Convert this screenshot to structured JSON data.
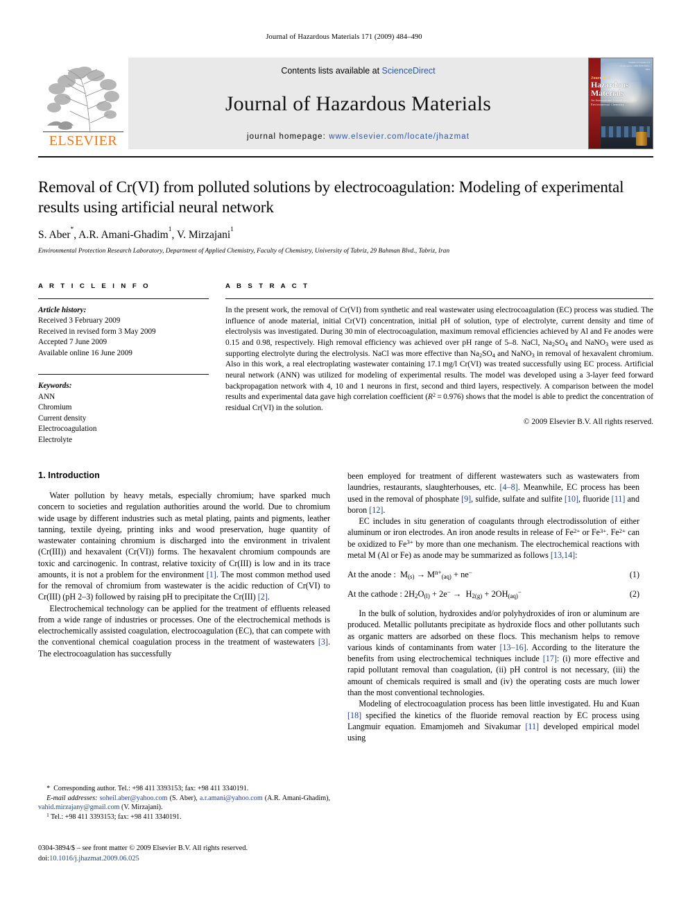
{
  "running_head": "Journal of Hazardous Materials 171 (2009) 484–490",
  "masthead": {
    "publisher_name": "ELSEVIER",
    "contents_prefix": "Contents lists available at ",
    "contents_link": "ScienceDirect",
    "journal_title": "Journal of Hazardous Materials",
    "homepage_prefix": "journal homepage:",
    "homepage_url": "www.elsevier.com/locate/jhazmat",
    "cover": {
      "line_small": "Journal of",
      "line_big_1": "Hazardous",
      "line_big_2": "Materials",
      "line_sub_1": "An International Journal devoted to",
      "line_sub_2": "Environmental Chemistry",
      "top_text_1": "Volume 171 Issues 1-3",
      "top_text_2": "15 November 2009 ISSN 0304-3894"
    }
  },
  "title": "Removal of Cr(VI) from polluted solutions by electrocoagulation: Modeling of experimental results using artificial neural network",
  "authors_html": "S. Aber<sup>*</sup>, A.R. Amani-Ghadim<sup>1</sup>, V. Mirzajani<sup>1</sup>",
  "affiliation": "Environmental Protection Research Laboratory, Department of Applied Chemistry, Faculty of Chemistry, University of Tabriz, 29 Bahman Blvd., Tabriz, Iran",
  "article_info": {
    "heading": "A R T I C L E   I N F O",
    "history_label": "Article history:",
    "history": [
      "Received 3 February 2009",
      "Received in revised form 3 May 2009",
      "Accepted 7 June 2009",
      "Available online 16 June 2009"
    ],
    "keywords_label": "Keywords:",
    "keywords": [
      "ANN",
      "Chromium",
      "Current density",
      "Electrocoagulation",
      "Electrolyte"
    ]
  },
  "abstract": {
    "heading": "A B S T R A C T",
    "body_html": "In the present work, the removal of Cr(VI) from synthetic and real wastewater using electrocoagulation (EC) process was studied. The influence of anode material, initial Cr(VI) concentration, initial pH of solution, type of electrolyte, current density and time of electrolysis was investigated. During 30&thinsp;min of electrocoagulation, maximum removal efficiencies achieved by Al and Fe anodes were 0.15 and 0.98, respectively. High removal efficiency was achieved over pH range of 5–8. NaCl, Na<sub>2</sub>SO<sub>4</sub> and NaNO<sub>3</sub> were used as supporting electrolyte during the electrolysis. NaCl was more effective than Na<sub>2</sub>SO<sub>4</sub> and NaNO<sub>3</sub> in removal of hexavalent chromium. Also in this work, a real electroplating wastewater containing 17.1&thinsp;mg/l Cr(VI) was treated successfully using EC process. Artificial neural network (ANN) was utilized for modeling of experimental results. The model was developed using a 3-layer feed forward backpropagation network with 4, 10 and 1 neurons in first, second and third layers, respectively. A comparison between the model results and experimental data gave high correlation coefficient (<i>R</i><sup>2</sup>&thinsp;=&thinsp;0.976) shows that the model is able to predict the concentration of residual Cr(VI) in the solution.",
    "copyright": "© 2009 Elsevier B.V. All rights reserved."
  },
  "section1": {
    "title": "1.  Introduction",
    "left_paragraphs_html": [
      "Water pollution by heavy metals, especially chromium; have sparked much concern to societies and regulation authorities around the world. Due to chromium wide usage by different industries such as metal plating, paints and pigments, leather tanning, textile dyeing, printing inks and wood preservation, huge quantity of wastewater containing chromium is discharged into the environment in trivalent (Cr(III)) and hexavalent (Cr(VI)) forms. The hexavalent chromium compounds are toxic and carcinogenic. In contrast, relative toxicity of Cr(III) is low and in its trace amounts, it is not a problem for the environment <span class=\"ref\">[1]</span>. The most common method used for the removal of chromium from wastewater is the acidic reduction of Cr(VI) to Cr(III) (pH 2–3) followed by raising pH to precipitate the Cr(III) <span class=\"ref\">[2]</span>.",
      "Electrochemical technology can be applied for the treatment of effluents released from a wide range of industries or processes. One of the electrochemical methods is electrochemically assisted coagulation, electrocoagulation (EC), that can compete with the conventional chemical coagulation process in the treatment of wastewaters <span class=\"ref\">[3]</span>. The electrocoagulation has successfully"
    ],
    "right_paragraphs_html": [
      "been employed for treatment of different wastewaters such as wastewaters from laundries, restaurants, slaughterhouses, etc. <span class=\"ref\">[4–8]</span>. Meanwhile, EC process has been used in the removal of phosphate <span class=\"ref\">[9]</span>, sulfide, sulfate and sulfite <span class=\"ref\">[10]</span>, fluoride <span class=\"ref\">[11]</span> and boron <span class=\"ref\">[12]</span>.",
      "EC includes in situ generation of coagulants through electrodissolution of either aluminum or iron electrodes. An iron anode results in release of Fe<sup>2+</sup> or Fe<sup>3+</sup>. Fe<sup>2+</sup> can be oxidized to Fe<sup>3+</sup> by more than one mechanism. The electrochemical reactions with metal M (Al or Fe) as anode may be summarized as follows <span class=\"ref\">[13,14]</span>:"
    ],
    "equations": [
      {
        "body_html": "At the anode :&nbsp; M<sub>(s)</sub> → M<sup>n+</sup><sub>(aq)</sub> + ne<sup>−</sup>",
        "number": "(1)"
      },
      {
        "body_html": "At the cathode : 2H<sub>2</sub>O<sub>(l)</sub> + 2e<sup>−</sup> → &nbsp;H<sub>2(g)</sub> + 2OH<sub>(aq)</sub><sup>−</sup>",
        "number": "(2)"
      }
    ],
    "right_paragraphs_after_eq_html": [
      "In the bulk of solution, hydroxides and/or polyhydroxides of iron or aluminum are produced. Metallic pollutants precipitate as hydroxide flocs and other pollutants such as organic matters are adsorbed on these flocs. This mechanism helps to remove various kinds of contaminants from water <span class=\"ref\">[13–16]</span>. According to the literature the benefits from using electrochemical techniques include <span class=\"ref\">[17]</span>: (i) more effective and rapid pollutant removal than coagulation, (ii) pH control is not necessary, (iii) the amount of chemicals required is small and (iv) the operating costs are much lower than the most conventional technologies.",
      "Modeling of electrocoagulation process has been little investigated. Hu and Kuan <span class=\"ref\">[18]</span> specified the kinetics of the fluoride removal reaction by EC process using Langmuir equation. Emamjomeh and Sivakumar <span class=\"ref\">[11]</span> developed empirical model using"
    ]
  },
  "footnotes": {
    "corresponding_html": "<span class=\"star\">*</span>&nbsp; Corresponding author. Tel.: +98 411 3393153; fax: +98 411 3340191.",
    "emails_html": "<span class=\"ital\">E-mail addresses:</span> <span class=\"link-blue\">soheil.aber@yahoo.com</span> (S. Aber), <span class=\"link-blue\">a.r.amani@yahoo.com</span> (A.R. Amani-Ghadim), <span class=\"link-blue\">vahid.mirzajany@gmail.com</span> (V. Mirzajani).",
    "tel_html": "<sup>1</sup> Tel.: +98 411 3393153; fax: +98 411 3340191."
  },
  "footer": {
    "issn_line": "0304-3894/$ – see front matter © 2009 Elsevier B.V. All rights reserved.",
    "doi_label": "doi:",
    "doi_value": "10.1016/j.jhazmat.2009.06.025"
  }
}
